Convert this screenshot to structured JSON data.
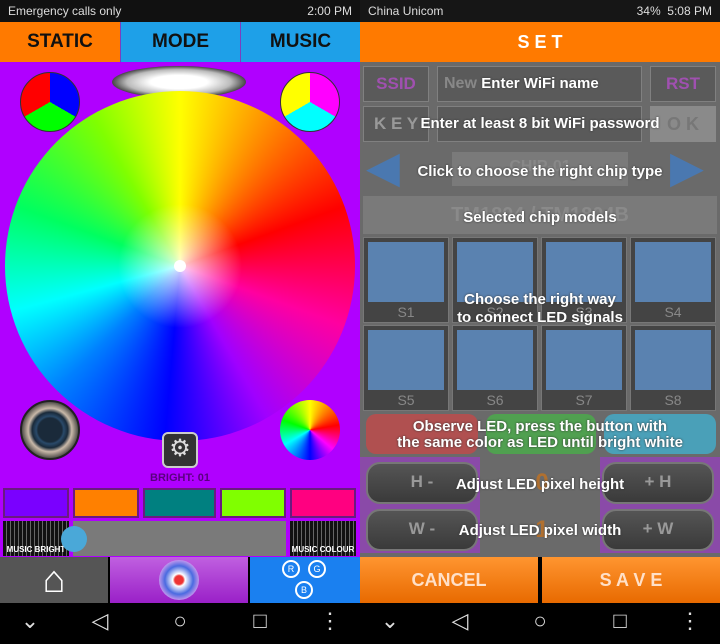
{
  "left": {
    "status": {
      "carrier": "Emergency calls only",
      "time": "2:00 PM"
    },
    "tabs": [
      {
        "label": "STATIC",
        "active": true,
        "color": "#ff7a00"
      },
      {
        "label": "MODE",
        "color": "#1ea0e8"
      },
      {
        "label": "MUSIC",
        "color": "#1ea0e8"
      }
    ],
    "background": "#b000ff",
    "bright_label": "BRIGHT: 01",
    "brightness": 1,
    "swatches": [
      "#7a00ff",
      "#ff8000",
      "#008080",
      "#80ff00",
      "#ff0080"
    ],
    "music_bright": "MUSIC BRIGHT",
    "music_colour": "MUSIC COLOUR",
    "slider_value": 0,
    "bottom_nav": [
      {
        "icon": "wifi-home-icon"
      },
      {
        "icon": "power-icon"
      },
      {
        "icon": "rgb-icon",
        "labels": [
          "R",
          "G",
          "B"
        ]
      }
    ]
  },
  "right": {
    "status": {
      "carrier": "China Unicom",
      "battery": "34%",
      "time": "5:08 PM"
    },
    "header": "S E T",
    "ssid_label": "SSID",
    "ssid_value": "New",
    "rst": "RST",
    "key_label": "K E Y",
    "ok": "O K",
    "chip": "CHIP-01",
    "chip_model": "TM1804 / TM1804B",
    "layouts": [
      "S1",
      "S2",
      "S3",
      "S4",
      "S5",
      "S6",
      "S7",
      "S8"
    ],
    "height_minus": "H -",
    "height_plus": "+ H",
    "height_value": "0",
    "width_minus": "W -",
    "width_plus": "+ W",
    "width_value": "1",
    "hints": {
      "wifi_name": "Enter WiFi name",
      "password": "Enter at least 8 bit WiFi password",
      "chip_type": "Click to choose the right chip type",
      "chip_models": "Selected chip models",
      "connect1": "Choose the right way",
      "connect2": "to connect LED signals",
      "observe1": "Observe LED, press the button with",
      "observe2": "the same color as LED until bright white",
      "height": "Adjust LED pixel height",
      "width": "Adjust LED pixel width"
    },
    "cancel": "CANCEL",
    "save": "S A V E"
  }
}
